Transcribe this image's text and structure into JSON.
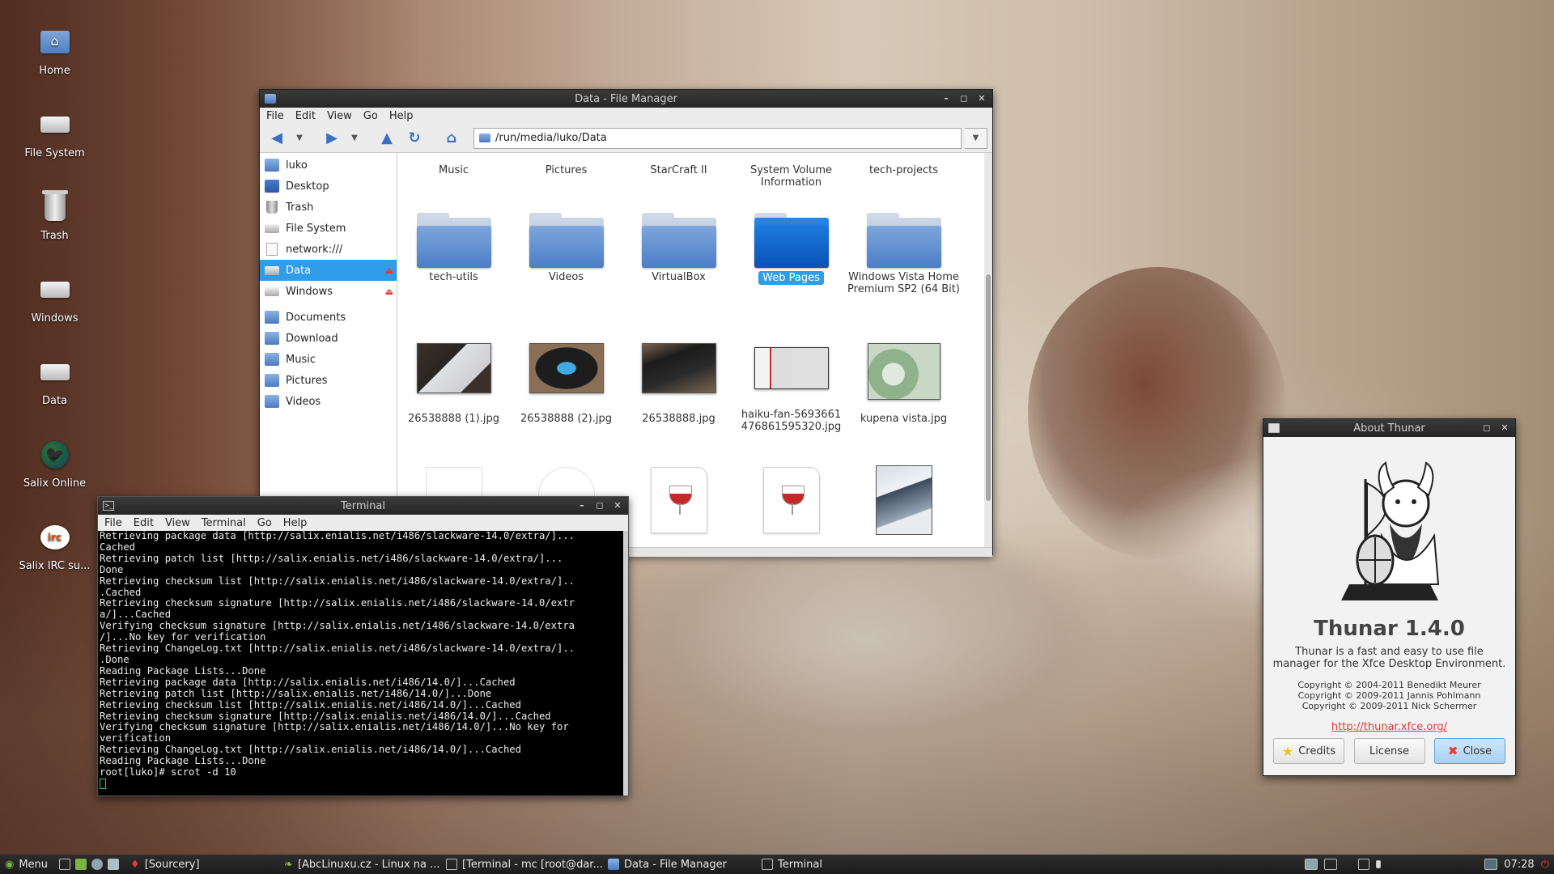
{
  "desktop": {
    "icons": [
      {
        "label": "Home"
      },
      {
        "label": "File System"
      },
      {
        "label": "Trash"
      },
      {
        "label": "Windows"
      },
      {
        "label": "Data"
      },
      {
        "label": "Salix Online"
      },
      {
        "label": "Salix IRC su..."
      }
    ]
  },
  "file_manager": {
    "title": "Data - File Manager",
    "menu": [
      "File",
      "Edit",
      "View",
      "Go",
      "Help"
    ],
    "location": "/run/media/luko/Data",
    "sidebar": [
      {
        "label": "luko"
      },
      {
        "label": "Desktop"
      },
      {
        "label": "Trash"
      },
      {
        "label": "File System"
      },
      {
        "label": "network:///"
      },
      {
        "label": "Data"
      },
      {
        "label": "Windows"
      },
      {
        "label": "Documents"
      },
      {
        "label": "Download"
      },
      {
        "label": "Music"
      },
      {
        "label": "Pictures"
      },
      {
        "label": "Videos"
      }
    ],
    "row0": [
      "Music",
      "Pictures",
      "StarCraft II",
      "System Volume Information",
      "tech-projects"
    ],
    "row1": [
      "tech-utils",
      "Videos",
      "VirtualBox",
      "Web Pages",
      "Windows Vista Home Premium SP2 (64 Bit)"
    ],
    "row2": [
      "26538888 (1).jpg",
      "26538888 (2).jpg",
      "26538888.jpg",
      "haiku-fan-5693661476861595320.jpg",
      "kupena vista.jpg"
    ]
  },
  "terminal": {
    "title": "Terminal",
    "menu": [
      "File",
      "Edit",
      "View",
      "Terminal",
      "Go",
      "Help"
    ],
    "output": "Retrieving package data [http://salix.enialis.net/i486/slackware-14.0/extra/]...\nCached\nRetrieving patch list [http://salix.enialis.net/i486/slackware-14.0/extra/]...\nDone\nRetrieving checksum list [http://salix.enialis.net/i486/slackware-14.0/extra/]..\n.Cached\nRetrieving checksum signature [http://salix.enialis.net/i486/slackware-14.0/extr\na/]...Cached\nVerifying checksum signature [http://salix.enialis.net/i486/slackware-14.0/extra\n/]...No key for verification\nRetrieving ChangeLog.txt [http://salix.enialis.net/i486/slackware-14.0/extra/]..\n.Done\nReading Package Lists...Done\nRetrieving package data [http://salix.enialis.net/i486/14.0/]...Cached\nRetrieving patch list [http://salix.enialis.net/i486/14.0/]...Done\nRetrieving checksum list [http://salix.enialis.net/i486/14.0/]...Cached\nRetrieving checksum signature [http://salix.enialis.net/i486/14.0/]...Cached\nVerifying checksum signature [http://salix.enialis.net/i486/14.0/]...No key for\nverification\nRetrieving ChangeLog.txt [http://salix.enialis.net/i486/14.0/]...Cached\nReading Package Lists...Done\nroot[luko]# scrot -d 10"
  },
  "about": {
    "title": "About Thunar",
    "app_name": "Thunar 1.4.0",
    "description": "Thunar is a fast and easy to use file manager for the Xfce Desktop Environment.",
    "copyright": [
      "Copyright © 2004-2011 Benedikt Meurer",
      "Copyright © 2009-2011 Jannis Pohlmann",
      "Copyright © 2009-2011 Nick Schermer"
    ],
    "link": "http://thunar.xfce.org/",
    "credits_label": "Credits",
    "license_label": "License",
    "close_label": "Close"
  },
  "taskbar": {
    "menu_label": "Menu",
    "tasks": [
      {
        "label": "[Sourcery]"
      },
      {
        "label": "[AbcLinuxu.cz - Linux na ..."
      },
      {
        "label": "[Terminal - mc [root@dar..."
      },
      {
        "label": "Data - File Manager"
      },
      {
        "label": "Terminal"
      }
    ],
    "clock": "07:28"
  }
}
